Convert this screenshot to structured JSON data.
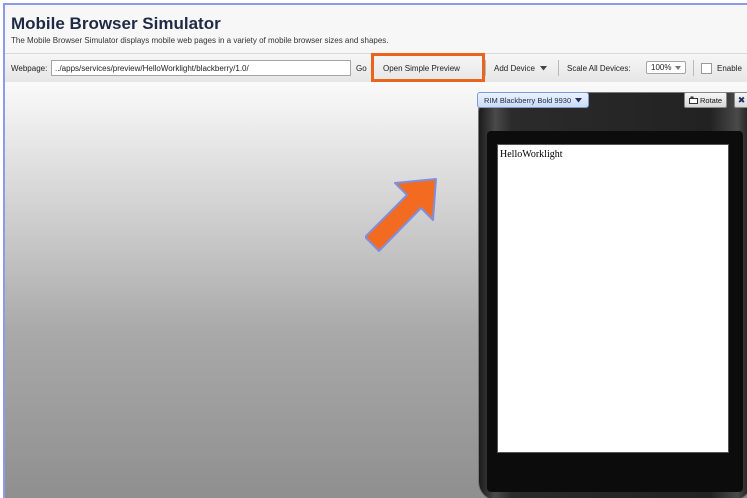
{
  "header": {
    "title": "Mobile Browser Simulator",
    "subtitle": "The Mobile Browser Simulator displays mobile web pages in a variety of mobile browser sizes and shapes."
  },
  "toolbar": {
    "webpage_label": "Webpage:",
    "url_value": "../apps/services/preview/HelloWorklight/blackberry/1.0/",
    "go_label": "Go",
    "simple_preview_label": "Open Simple Preview",
    "add_device_label": "Add Device",
    "scale_label": "Scale All Devices:",
    "scale_value": "100%",
    "enable_label": "Enable"
  },
  "device": {
    "name": "RIM Blackberry Bold 9930",
    "rotate_label": "Rotate",
    "close_label": "✖",
    "screen_text": "HelloWorklight"
  },
  "colors": {
    "highlight": "#e8651f",
    "arrow": "#f26b21",
    "arrow_outline": "#7f8fe0",
    "frame_border": "#8c9ae8",
    "title": "#1f2a44"
  },
  "icons": {
    "rotate": "rotate-icon",
    "dropdown": "chevron-down-icon",
    "annotation": "arrow-icon"
  }
}
